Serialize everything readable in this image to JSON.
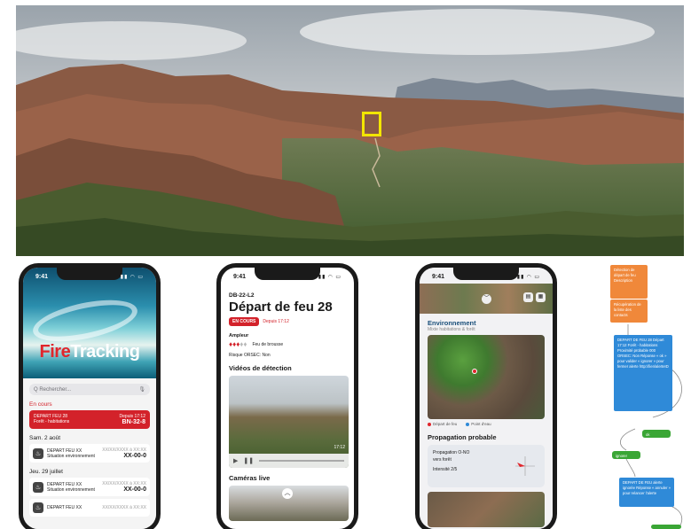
{
  "phone1": {
    "time": "9:41",
    "brand_a": "Fire",
    "brand_b": "Tracking",
    "search_placeholder": "Q Rechercher...",
    "in_progress_title": "En cours",
    "active": {
      "title": "DEPART FEU 28",
      "subtitle": "Forêt - habitations",
      "since": "Depuis 17:12",
      "code": "BN-32-8"
    },
    "group1_title": "Sam. 2 août",
    "group2_title": "Jeu. 29 juillet",
    "events": [
      {
        "title": "DEPART FEU XX",
        "subtitle": "Situation environnement",
        "date": "XX/XX/XXXX à XX:XX",
        "code": "XX-00-0"
      },
      {
        "title": "DEPART FEU XX",
        "subtitle": "Situation environnement",
        "date": "XX/XX/XXXX à XX:XX",
        "code": "XX-00-0"
      },
      {
        "title": "DEPART FEU XX",
        "subtitle": "",
        "date": "XX/XX/XXXX à XX:XX",
        "code": ""
      }
    ]
  },
  "phone2": {
    "time": "9:41",
    "code": "DB-22-L2",
    "title": "Départ de feu 28",
    "status_badge": "EN COURS",
    "since": "Depuis 17:12",
    "amplitude_label": "Ampleur",
    "fire_type": "Feu de brousse",
    "fire_level": 3,
    "fire_level_max": 5,
    "risk": "Risque ORSEC: Non",
    "videos_title": "Vidéos de détection",
    "video_time": "17:12",
    "cameras_title": "Caméras live"
  },
  "phone3": {
    "time": "9:41",
    "env_title": "Environnement",
    "env_subtitle": "Mixte habitations & forêt",
    "legend_fire": "Départ de feu",
    "legend_water": "Point d'eau",
    "propagation_title": "Propagation probable",
    "propagation_line1": "Propagation O-NO",
    "propagation_line2": "vers forêt",
    "intensity": "Intensité 2/5"
  },
  "flowchart": {
    "box1": "Détection de départ de feu Description",
    "box2": "Récupération de la liste des contacts",
    "box3": "DEPART DE FEU 28 Départ 17:12 Forêt - habitations Proximité probable 000 ORSEC: Non Réponse « ok » pour valider « ignorer » pour fermer alerte http://lien/alerteID",
    "box4": "ok",
    "box5": "ignorer",
    "box6": "DEPART DE FEU alerte ignorée Réponse « annuler » pour relancer l'alerte"
  },
  "colors": {
    "brand_red": "#d3222a",
    "flow_orange": "#f0883a",
    "flow_blue": "#2f8ad8",
    "flow_green": "#3aa635",
    "highlight_yellow": "#f2e600"
  },
  "icons": [
    "search-icon",
    "mic-icon",
    "fire-icon",
    "chevron-down-icon",
    "layers-icon",
    "play-icon",
    "pause-icon",
    "compass-icon"
  ]
}
